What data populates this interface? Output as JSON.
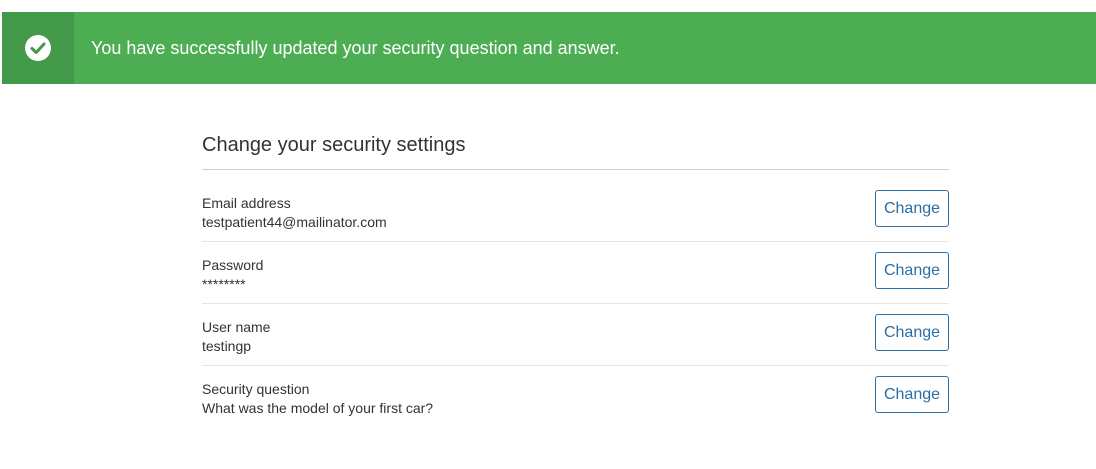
{
  "alert": {
    "icon": "check-circle-icon",
    "message": "You have successfully updated your security question and answer.",
    "color": "#4cad52",
    "icon_bg_color": "#43994a"
  },
  "panel": {
    "title": "Change your security settings",
    "rows": [
      {
        "label": "Email address",
        "value": "testpatient44@mailinator.com",
        "button": "Change"
      },
      {
        "label": "Password",
        "value": "********",
        "button": "Change"
      },
      {
        "label": "User name",
        "value": "testingp",
        "button": "Change"
      },
      {
        "label": "Security question",
        "value": "What was the model of your first car?",
        "button": "Change"
      }
    ]
  },
  "colors": {
    "button_border": "#2a6fa8",
    "text": "#333333"
  }
}
